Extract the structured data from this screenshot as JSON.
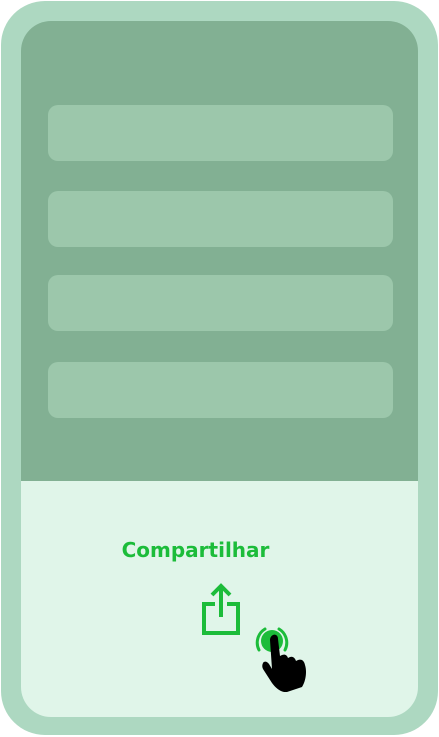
{
  "share": {
    "label": "Compartilhar",
    "icon": "share-icon"
  },
  "colors": {
    "frame": "#add8c1",
    "top_area": "#82b093",
    "placeholder": "#9cc7ab",
    "bottom_area": "#e0f5e9",
    "accent": "#1cbc3a"
  }
}
